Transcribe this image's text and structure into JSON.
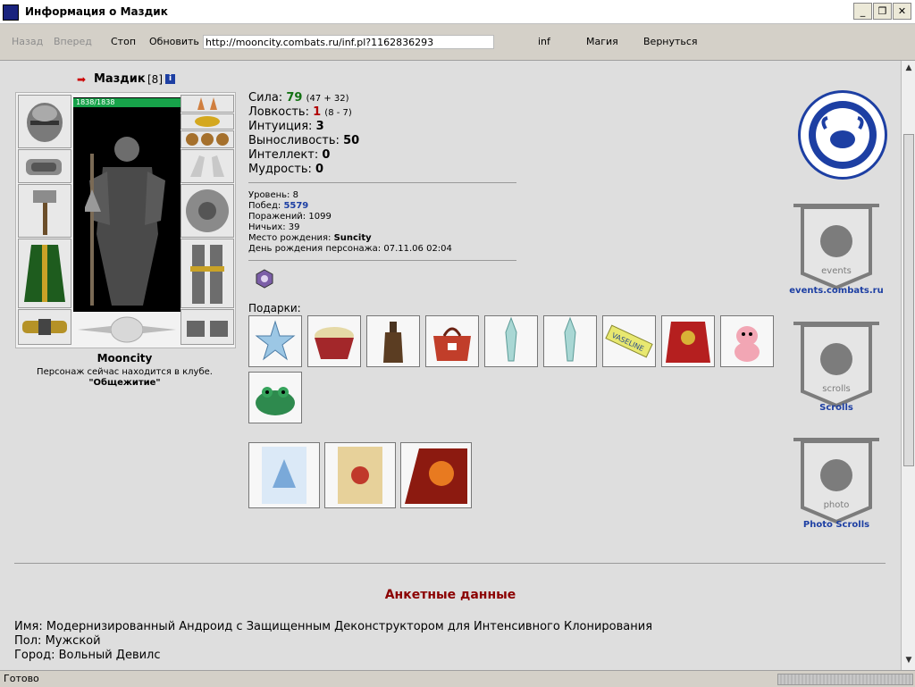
{
  "window": {
    "title": "Информация о Маздик",
    "buttons": {
      "minimize": "_",
      "maximize": "❐",
      "close": "✕"
    }
  },
  "toolbar": {
    "back": "Назад",
    "forward": "Вперед",
    "stop": "Стоп",
    "refresh": "Обновить",
    "address": "http://mooncity.combats.ru/inf.pl?1162836293",
    "inf": "inf",
    "magic": "Магия",
    "return": "Вернуться"
  },
  "status": {
    "text": "Готово"
  },
  "character": {
    "name": "Маздик",
    "level_label": "[8]",
    "hp_text": "1838/1838",
    "hp_fraction": 1.0,
    "city": "Mooncity",
    "location_text": "Персонаж сейчас находится в клубе.",
    "location_name": "\"Общежитие\""
  },
  "stats": [
    {
      "label": "Сила:",
      "value": "79",
      "extra": "(47 + 32)",
      "color": "#137113"
    },
    {
      "label": "Ловкость:",
      "value": "1",
      "extra": "(8 - 7)",
      "color": "#b00000"
    },
    {
      "label": "Интуиция:",
      "value": "3",
      "extra": "",
      "color": "#000000"
    },
    {
      "label": "Выносливость:",
      "value": "50",
      "extra": "",
      "color": "#000000"
    },
    {
      "label": "Интеллект:",
      "value": "0",
      "extra": "",
      "color": "#000000"
    },
    {
      "label": "Мудрость:",
      "value": "0",
      "extra": "",
      "color": "#000000"
    }
  ],
  "info": {
    "level_label": "Уровень:",
    "level_value": "8",
    "wins_label": "Побед:",
    "wins_value": "5579",
    "losses_label": "Поражений:",
    "losses_value": "1099",
    "draws_label": "Ничьих:",
    "draws_value": "39",
    "birthplace_label": "Место рождения:",
    "birthplace_value": "Suncity",
    "birthday_label": "День рождения персонажа:",
    "birthday_value": "07.11.06 02:04"
  },
  "gifts_label": "Подарки:",
  "gifts": [
    "snowflake",
    "bowl",
    "bottle",
    "bag",
    "crystal",
    "crystal",
    "vaseline",
    "cape",
    "cow",
    "frog"
  ],
  "vaseline_text": "VASELINE",
  "cards": [
    "card-2008-blue",
    "card-sketch",
    "card-2008-red"
  ],
  "side": {
    "events_label": "events.combats.ru",
    "events_banner_text": "events",
    "scrolls_label": "Scrolls",
    "scrolls_banner_text": "scrolls",
    "photo_label": "Photo Scrolls",
    "photo_banner_text": "photo"
  },
  "anketa": {
    "title": "Анкетные данные",
    "name_label": "Имя:",
    "name_value": "Модернизированный Андроид с Защищенным Деконструктором для Интенсивного Клонирования",
    "gender_label": "Пол:",
    "gender_value": "Мужской",
    "city_label": "Город:",
    "city_value": "Вольный Девилс"
  },
  "colors": {
    "accent_blue": "#1d3fa3",
    "wins_blue": "#1d3fa3",
    "anketa_title": "#8b0000"
  }
}
